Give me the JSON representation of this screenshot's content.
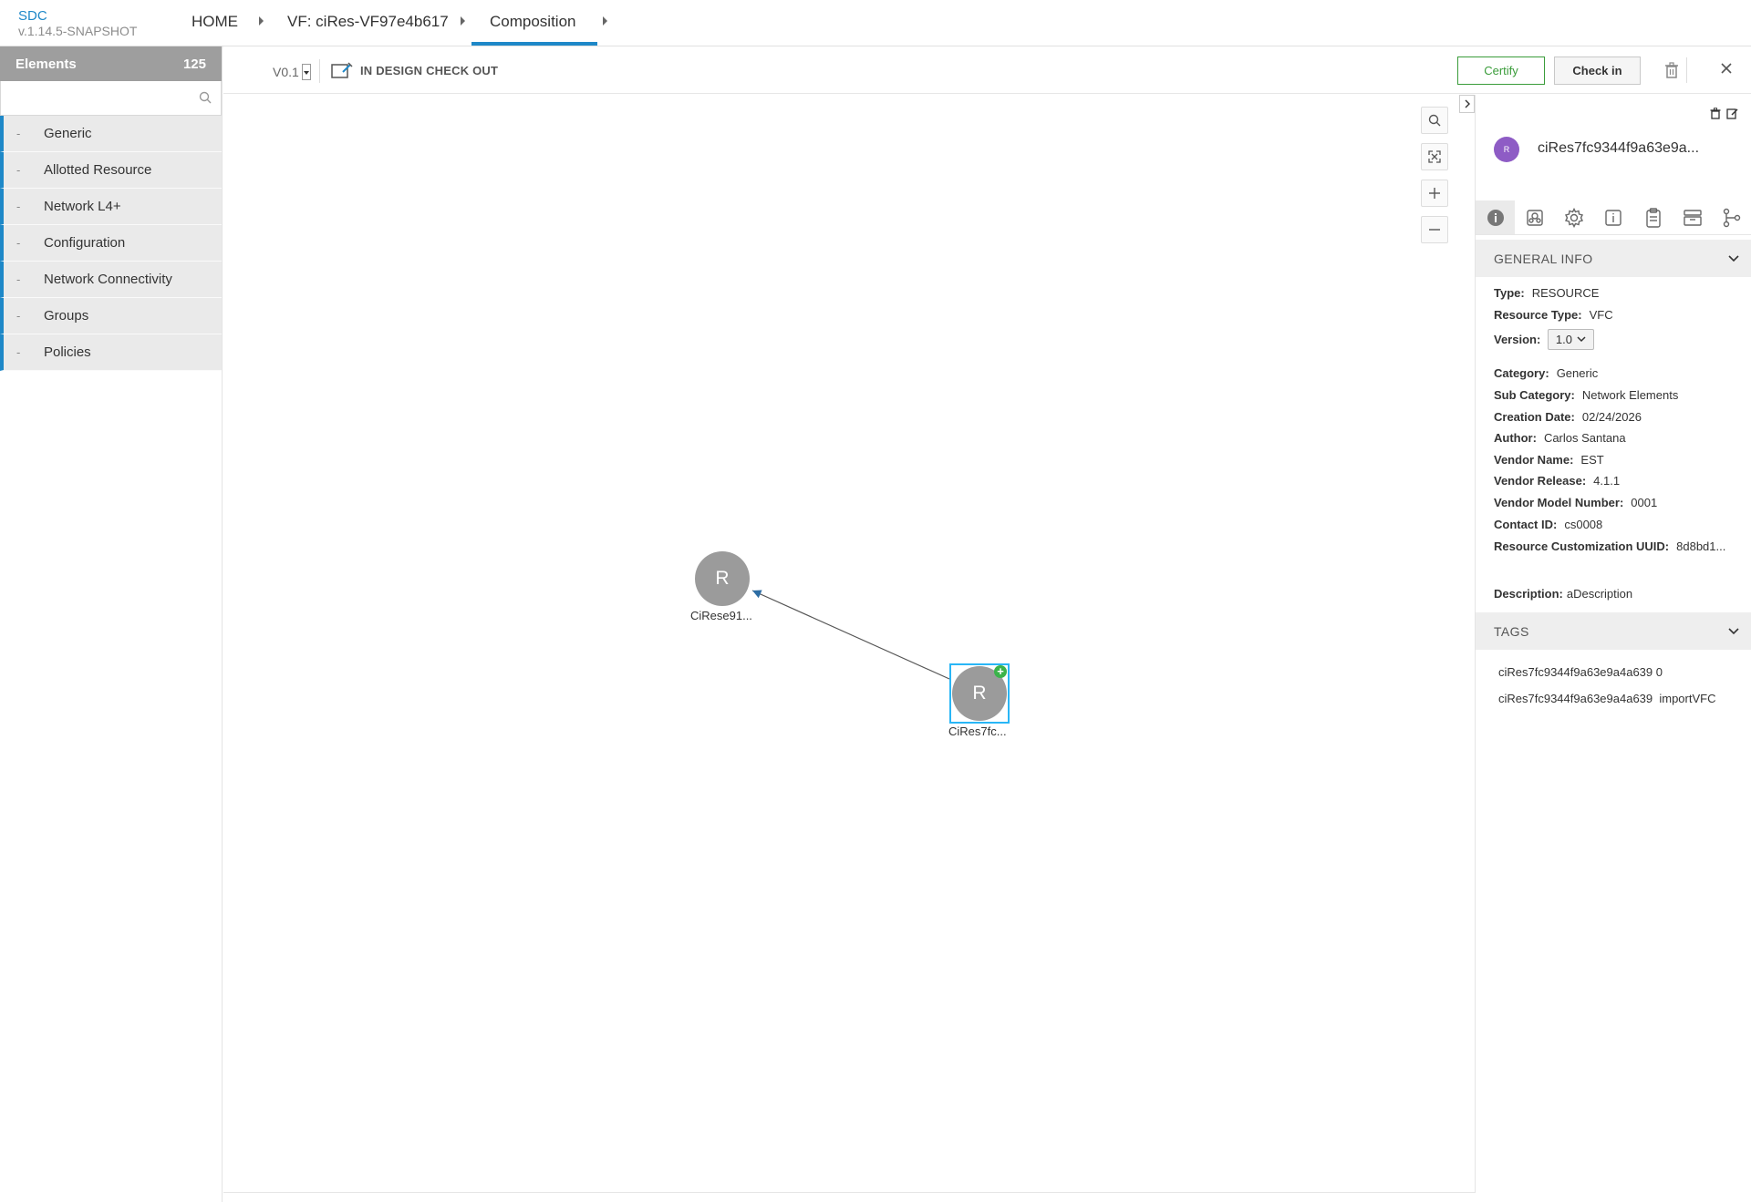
{
  "brand": {
    "name": "SDC",
    "version": "v.1.14.5-SNAPSHOT"
  },
  "breadcrumb": {
    "home": "HOME",
    "vf": "VF: ciRes-VF97e4b617",
    "current": "Composition"
  },
  "palette": {
    "title": "Elements",
    "count": "125",
    "search_placeholder": "",
    "categories": [
      "Generic",
      "Allotted Resource",
      "Network L4+",
      "Configuration",
      "Network Connectivity",
      "Groups",
      "Policies"
    ]
  },
  "toolbar": {
    "version": "V0.1",
    "status": "IN DESIGN CHECK OUT",
    "certify_label": "Certify",
    "checkin_label": "Check in"
  },
  "canvas": {
    "nodes": [
      {
        "letter": "R",
        "label": "CiRese91..."
      },
      {
        "letter": "R",
        "label": "CiRes7fc...",
        "selected": true
      }
    ]
  },
  "details": {
    "avatar_letter": "R",
    "title": "ciRes7fc9344f9a63e9a...",
    "general_info_header": "GENERAL INFO",
    "fields": {
      "type_label": "Type:",
      "type": "RESOURCE",
      "resource_type_label": "Resource Type:",
      "resource_type": "VFC",
      "version_label": "Version:",
      "version": "1.0",
      "category_label": "Category:",
      "category": "Generic",
      "sub_category_label": "Sub Category:",
      "sub_category": "Network Elements",
      "creation_date_label": "Creation Date:",
      "creation_date": "02/24/2026",
      "author_label": "Author:",
      "author": "Carlos Santana",
      "vendor_name_label": "Vendor Name:",
      "vendor_name": "EST",
      "vendor_release_label": "Vendor Release:",
      "vendor_release": "4.1.1",
      "vendor_model_label": "Vendor Model Number:",
      "vendor_model": "0001",
      "contact_label": "Contact ID:",
      "contact": "cs0008",
      "uuid_label": "Resource Customization UUID:",
      "uuid": "8d8bd1...",
      "description_label": "Description:",
      "description": "aDescription"
    },
    "tags_header": "TAGS",
    "tags": [
      "ciRes7fc9344f9a63e9a4a639 0",
      "ciRes7fc9344f9a63e9a4a639  importVFC"
    ]
  },
  "colors": {
    "accent": "#1e88c8",
    "certify": "#3a9c3a",
    "node": "#9b9b9b",
    "avatar": "#8e5cc5",
    "selection": "#29b6f6"
  }
}
